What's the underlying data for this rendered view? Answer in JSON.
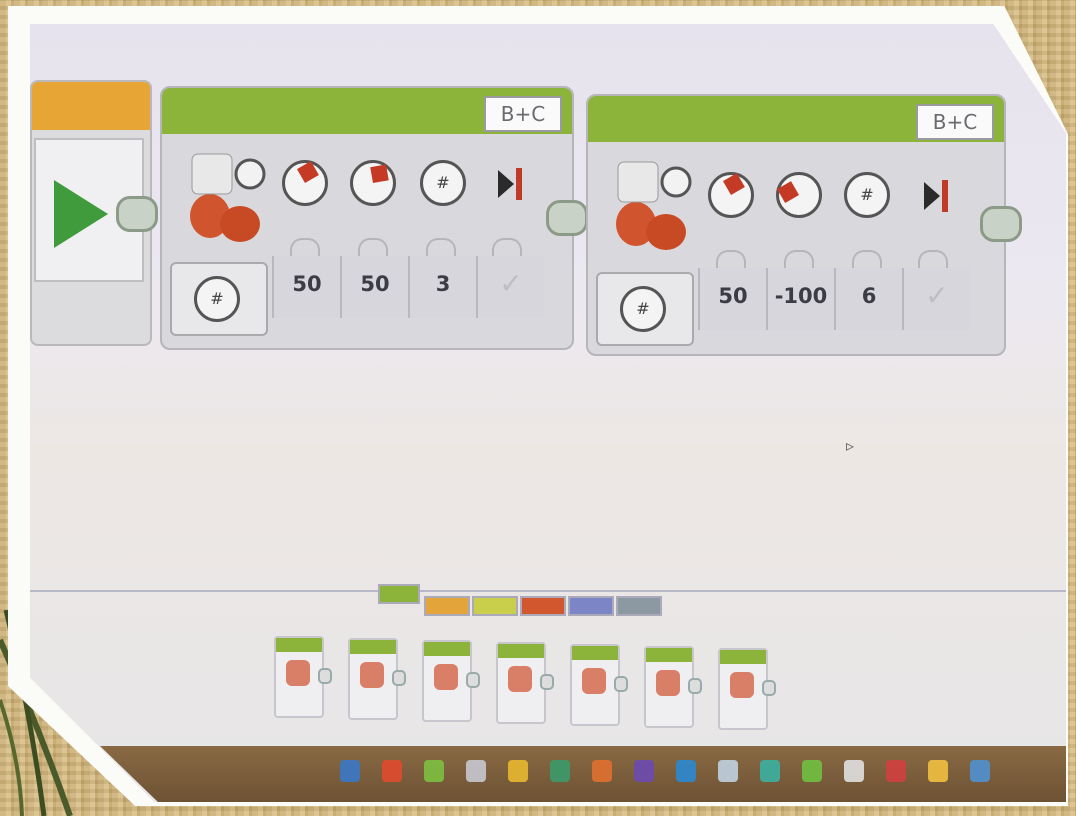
{
  "start_block": {
    "icon": "play-icon"
  },
  "blocks": [
    {
      "ports": "B+C",
      "values": [
        "50",
        "50",
        "3"
      ],
      "check": "✓"
    },
    {
      "ports": "B+C",
      "values": [
        "50",
        "-100",
        "6"
      ],
      "check": "✓"
    }
  ],
  "palette_tabs": [
    {
      "color": "#8cb43b"
    },
    {
      "color": "#e3a53a"
    },
    {
      "color": "#c9cf4a"
    },
    {
      "color": "#d2572f"
    },
    {
      "color": "#7c86c6"
    },
    {
      "color": "#8c98a2"
    }
  ],
  "palette_blocks": [
    "medium-motor",
    "large-motor",
    "move-steering",
    "move-tank",
    "display",
    "sound",
    "brick-status-light"
  ],
  "taskbar_icons": [
    {
      "color": "#3a78c8"
    },
    {
      "color": "#e04a2e"
    },
    {
      "color": "#7cc040"
    },
    {
      "color": "#c8c8d0"
    },
    {
      "color": "#e8b830"
    },
    {
      "color": "#3a9a6a"
    },
    {
      "color": "#e07030"
    },
    {
      "color": "#6a4ab0"
    },
    {
      "color": "#2a8ad0"
    },
    {
      "color": "#c0d0e0"
    },
    {
      "color": "#3ab0a0"
    },
    {
      "color": "#70c040"
    },
    {
      "color": "#e0e0e0"
    },
    {
      "color": "#d04040"
    },
    {
      "color": "#f0c040"
    },
    {
      "color": "#5090d0"
    }
  ]
}
